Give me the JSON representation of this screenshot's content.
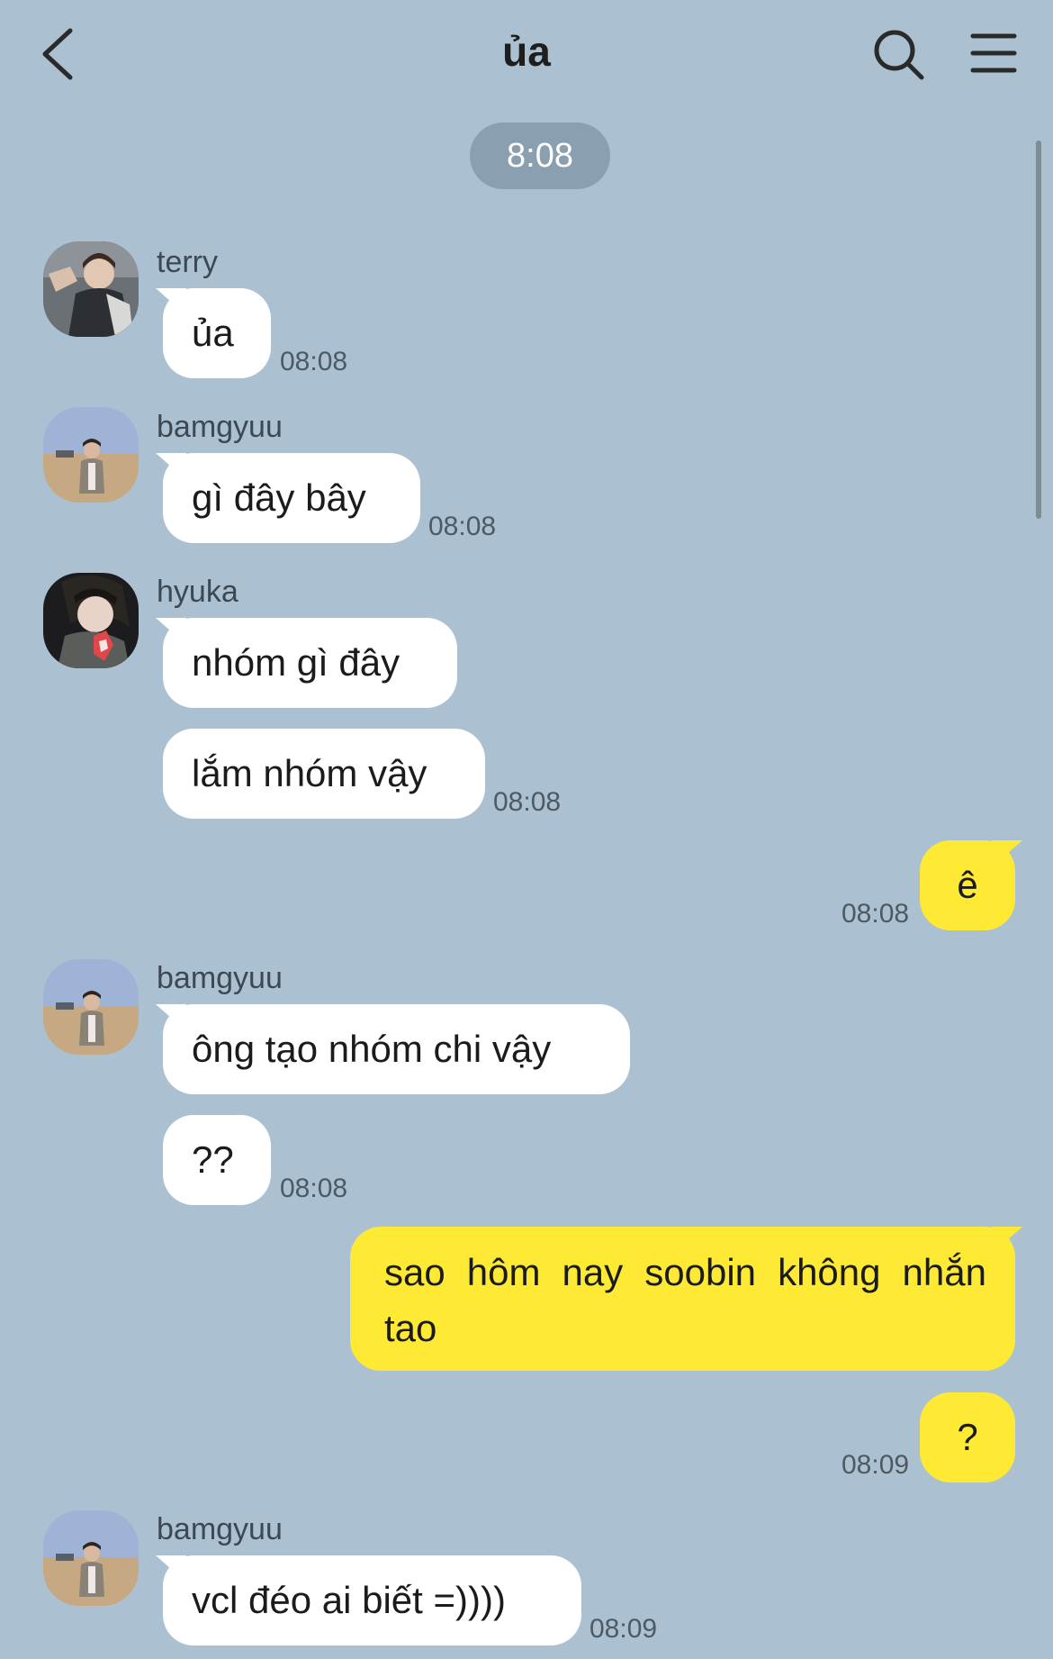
{
  "header": {
    "title": "ủa"
  },
  "time_divider": "8:08",
  "messages": [
    {
      "sender": "terry",
      "text": "ủa",
      "time": "08:08"
    },
    {
      "sender": "bamgyuu",
      "text": "gì đây bây",
      "time": "08:08"
    },
    {
      "sender": "hyuka",
      "text": "nhóm gì đây"
    },
    {
      "text": "lắm nhóm vậy",
      "time": "08:08"
    },
    {
      "sender": "me",
      "text": "ê",
      "time": "08:08"
    },
    {
      "sender": "bamgyuu",
      "text": "ông tạo nhóm chi vậy"
    },
    {
      "text": "??",
      "time": "08:08"
    },
    {
      "sender": "me",
      "text": "sao hôm nay soobin không nhắn tao"
    },
    {
      "sender": "me",
      "text": "?",
      "time": "08:09"
    },
    {
      "sender": "bamgyuu",
      "text": "vcl đéo ai biết =))))",
      "time": "08:09"
    }
  ],
  "colors": {
    "background": "#abc1d1",
    "my_bubble": "#fee934",
    "other_bubble": "#ffffff",
    "time_chip": "#8aa0b0"
  },
  "icons": [
    "back-arrow-icon",
    "search-icon",
    "menu-icon"
  ]
}
